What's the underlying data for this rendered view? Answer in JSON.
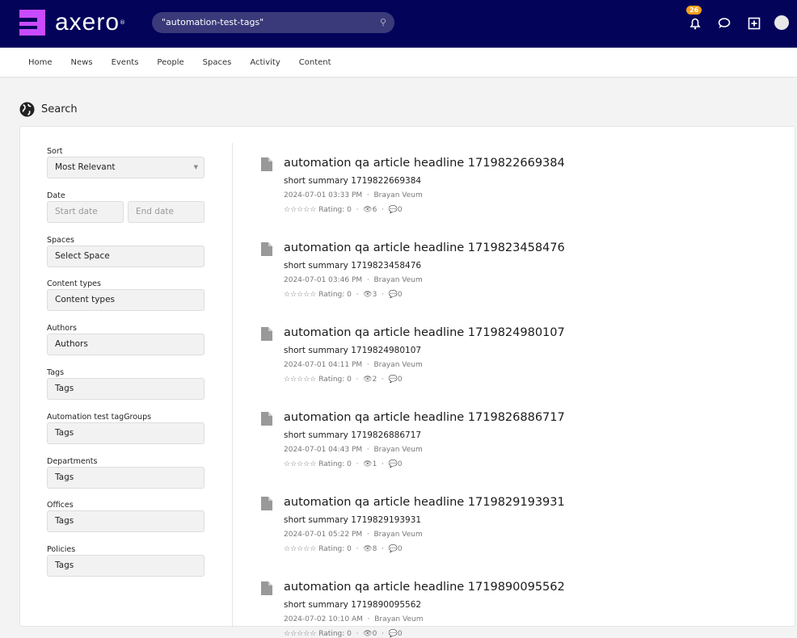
{
  "header": {
    "logo_text": "axero",
    "search_value": "\"automation-test-tags\"",
    "notification_count": "26"
  },
  "nav": [
    "Home",
    "News",
    "Events",
    "People",
    "Spaces",
    "Activity",
    "Content"
  ],
  "page_title": "Search",
  "filters": [
    {
      "label": "Sort",
      "value": "Most Relevant",
      "type": "select"
    },
    {
      "label": "Date",
      "start_placeholder": "Start date",
      "end_placeholder": "End date",
      "type": "date"
    },
    {
      "label": "Spaces",
      "value": "Select Space"
    },
    {
      "label": "Content types",
      "value": "Content types"
    },
    {
      "label": "Authors",
      "value": "Authors"
    },
    {
      "label": "Tags",
      "value": "Tags"
    },
    {
      "label": "Automation test tagGroups",
      "value": "Tags"
    },
    {
      "label": "Departments",
      "value": "Tags"
    },
    {
      "label": "Offices",
      "value": "Tags"
    },
    {
      "label": "Policies",
      "value": "Tags"
    }
  ],
  "results": [
    {
      "title": "automation qa article headline 1719822669384",
      "summary": "short summary 1719822669384",
      "date": "2024-07-01 03:33 PM",
      "author": "Brayan Veum",
      "rating": "Rating: 0",
      "views": "6",
      "comments": "0"
    },
    {
      "title": "automation qa article headline 1719823458476",
      "summary": "short summary 1719823458476",
      "date": "2024-07-01 03:46 PM",
      "author": "Brayan Veum",
      "rating": "Rating: 0",
      "views": "3",
      "comments": "0"
    },
    {
      "title": "automation qa article headline 1719824980107",
      "summary": "short summary 1719824980107",
      "date": "2024-07-01 04:11 PM",
      "author": "Brayan Veum",
      "rating": "Rating: 0",
      "views": "2",
      "comments": "0"
    },
    {
      "title": "automation qa article headline 1719826886717",
      "summary": "short summary 1719826886717",
      "date": "2024-07-01 04:43 PM",
      "author": "Brayan Veum",
      "rating": "Rating: 0",
      "views": "1",
      "comments": "0"
    },
    {
      "title": "automation qa article headline 1719829193931",
      "summary": "short summary 1719829193931",
      "date": "2024-07-01 05:22 PM",
      "author": "Brayan Veum",
      "rating": "Rating: 0",
      "views": "8",
      "comments": "0"
    },
    {
      "title": "automation qa article headline 1719890095562",
      "summary": "short summary 1719890095562",
      "date": "2024-07-02 10:10 AM",
      "author": "Brayan Veum",
      "rating": "Rating: 0",
      "views": "0",
      "comments": "0"
    }
  ]
}
